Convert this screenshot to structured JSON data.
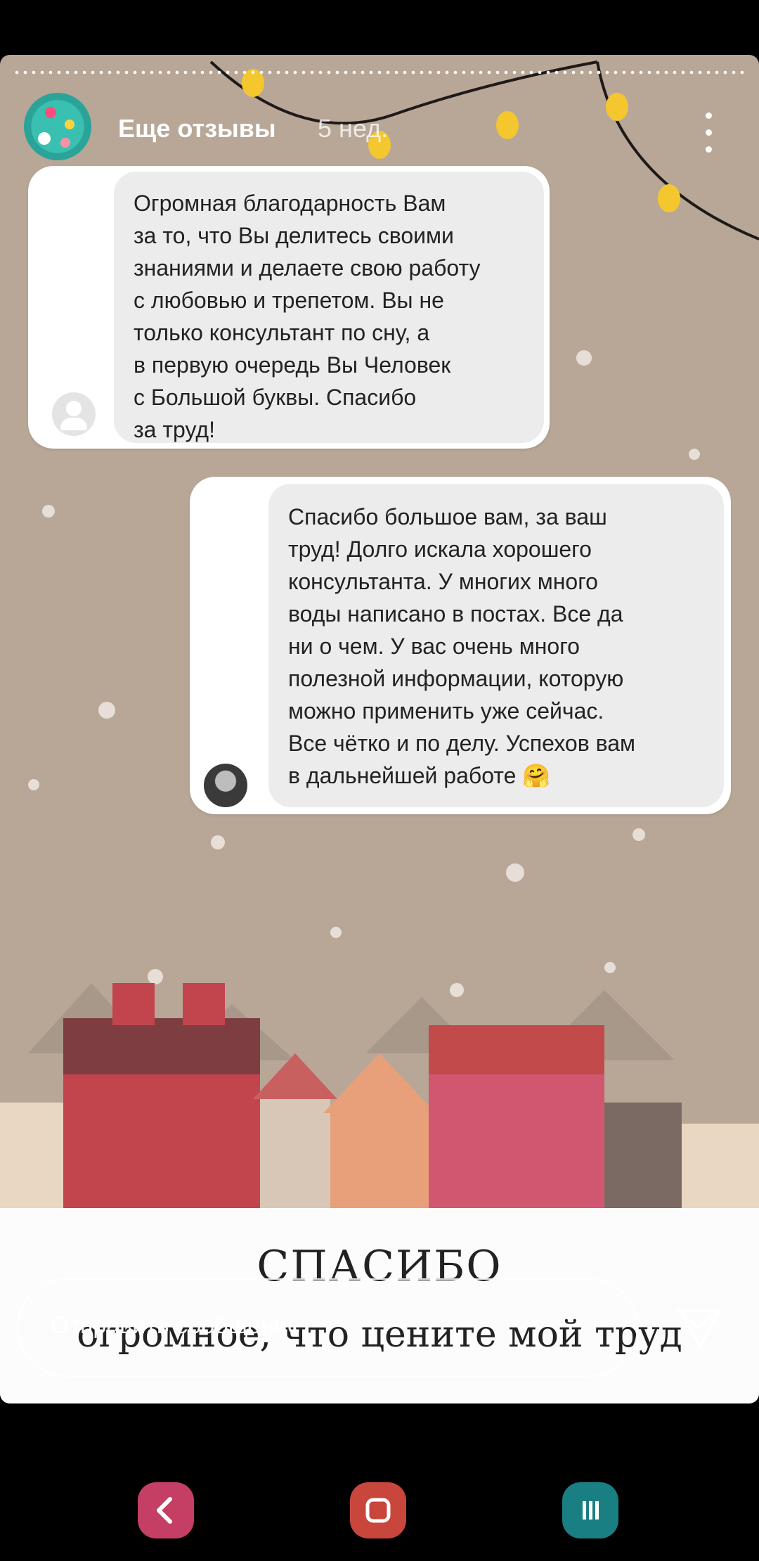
{
  "story": {
    "author": "Еще отзывы",
    "time": "5 нед."
  },
  "messages": [
    {
      "text": "Огромная благодарность Вам\nза то, что Вы делитесь своими\nзнаниями и делаете свою работу\nс любовью и трепетом. Вы не\nтолько консультант по сну, а\nв первую очередь Вы Человек\nс Большой буквы. Спасибо\nза труд!"
    },
    {
      "text": "Спасибо большое вам, за ваш\nтруд! Долго искала хорошего\nконсультанта. У многих много\nводы написано в постах. Все да\nни о чем. У вас очень много\nполезной информации, которую\nможно применить уже сейчас.\nВсе чётко и по делу. Успехов вам\nв дальнейшей работе 🤗"
    }
  ],
  "banner": {
    "title": "СПАСИБО",
    "subtitle": "огромное, что цените мой труд"
  },
  "reply": {
    "placeholder": "Отправить сообщение"
  },
  "icons": {
    "menu": "more-vertical-icon",
    "send": "paper-plane-icon",
    "back": "back-icon",
    "home": "home-icon",
    "recents": "recents-icon"
  },
  "colors": {
    "background": "#b8a797",
    "nav_back": "#c53e63",
    "nav_home": "#c8463c",
    "nav_recents": "#1a7f82"
  }
}
